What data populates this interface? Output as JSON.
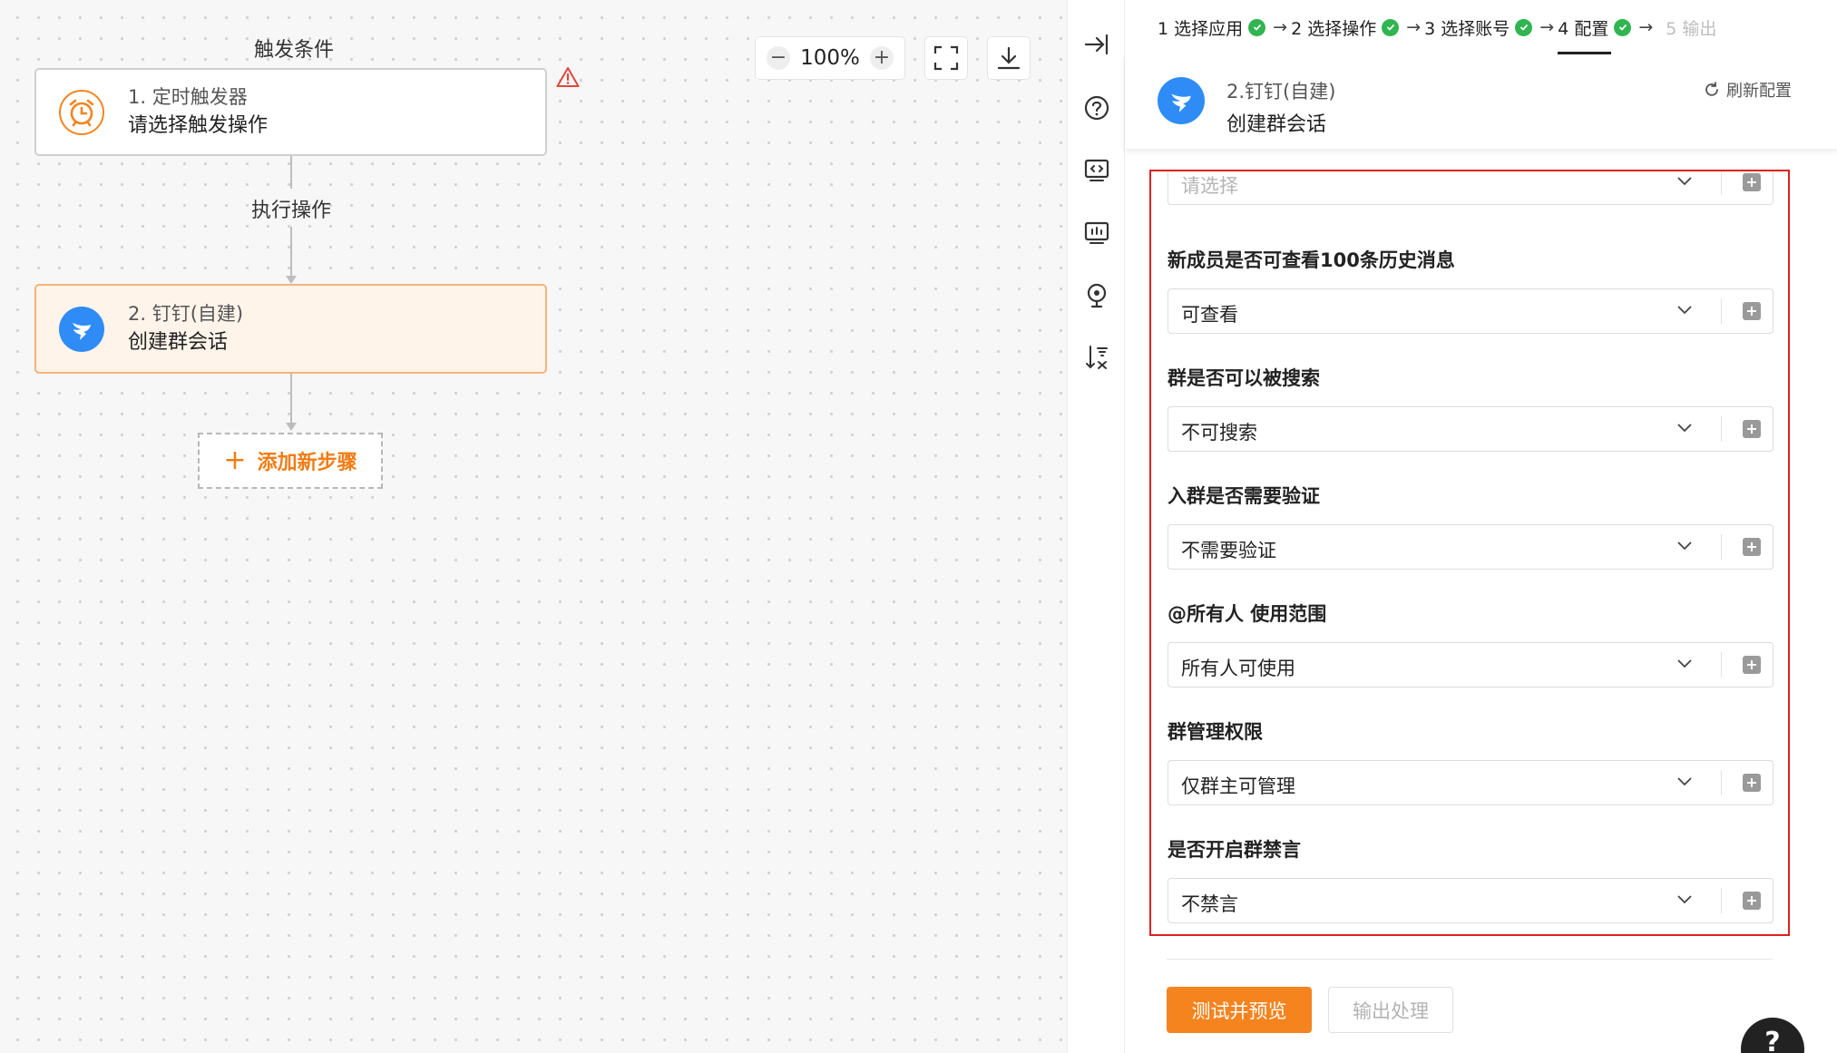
{
  "canvas": {
    "trigger_label": "触发条件",
    "action_label": "执行操作",
    "trigger_node": {
      "title": "1. 定时触发器",
      "subtitle": "请选择触发操作"
    },
    "action_node": {
      "title": "2. 钉钉(自建)",
      "subtitle": "创建群会话"
    },
    "add_step_label": "添加新步骤",
    "zoom": "100%",
    "icons": {
      "warning": "warning-icon",
      "clock": "alarm-clock-icon",
      "dingtalk": "dingtalk-icon"
    }
  },
  "rail": {
    "icons": [
      "collapse-right-icon",
      "help-circle-icon",
      "code-icon",
      "monitor-icon",
      "location-pin-icon",
      "sort-icon"
    ]
  },
  "steps": [
    {
      "label": "1 选择应用",
      "status": "done"
    },
    {
      "label": "2 选择操作",
      "status": "done"
    },
    {
      "label": "3 选择账号",
      "status": "done"
    },
    {
      "label": "4 配置",
      "status": "active"
    },
    {
      "label": "5 输出",
      "status": "disabled"
    }
  ],
  "header": {
    "app_name": "2.钉钉(自建)",
    "action_name": "创建群会话",
    "refresh_label": "刷新配置"
  },
  "form": {
    "top_select": {
      "placeholder": "请选择"
    },
    "fields": [
      {
        "label": "新成员是否可查看100条历史消息",
        "value": "可查看"
      },
      {
        "label": "群是否可以被搜索",
        "value": "不可搜索"
      },
      {
        "label": "入群是否需要验证",
        "value": "不需要验证"
      },
      {
        "label": "@所有人 使用范围",
        "value": "所有人可使用"
      },
      {
        "label": "群管理权限",
        "value": "仅群主可管理"
      },
      {
        "label": "是否开启群禁言",
        "value": "不禁言"
      }
    ]
  },
  "footer": {
    "test_preview_label": "测试并预览",
    "output_label": "输出处理",
    "help_symbol": "?"
  },
  "colors": {
    "accent": "#f5841f",
    "success": "#30b550",
    "highlight_border": "#e02020",
    "dingtalk_blue": "#2f8cf6"
  }
}
